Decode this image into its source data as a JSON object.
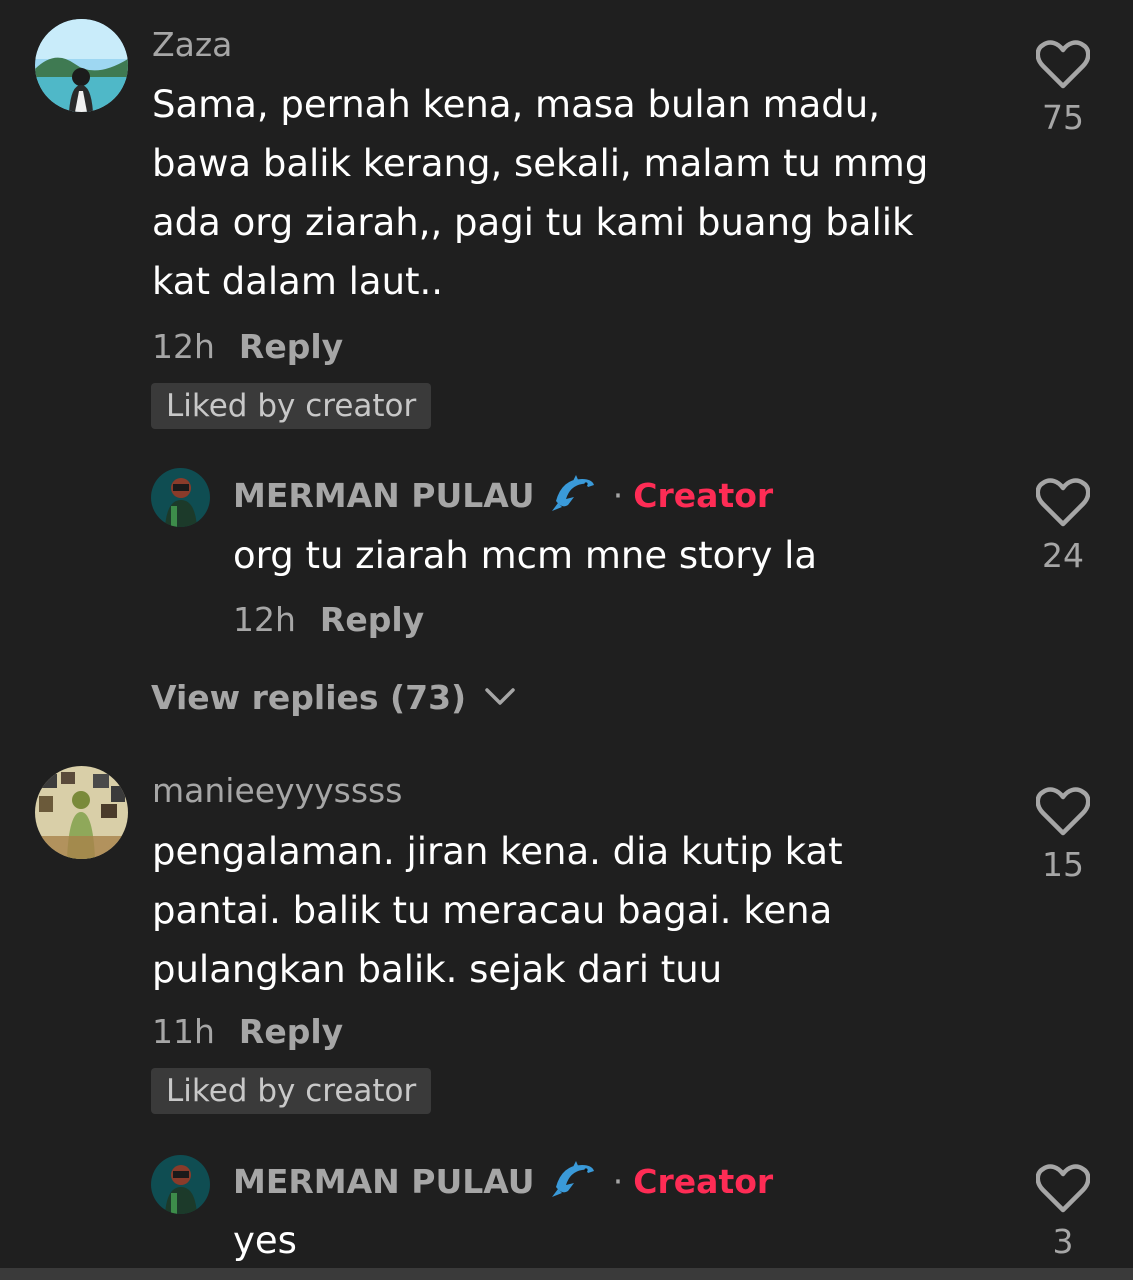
{
  "comments": [
    {
      "username": "Zaza",
      "text": "Sama, pernah kena, masa bulan madu, bawa balik kerang, sekali, malam tu mmg ada org ziarah,, pagi tu kami buang balik kat dalam laut..",
      "time": "12h",
      "reply_label": "Reply",
      "liked_badge": "Liked by creator",
      "likes": "75",
      "creator_reply": {
        "username": "MERMAN PULAU",
        "dot": "·",
        "creator_label": "Creator",
        "text": "org tu ziarah mcm mne story la",
        "time": "12h",
        "reply_label": "Reply",
        "likes": "24"
      },
      "view_replies": "View replies (73)"
    },
    {
      "username": "manieeyyyssss",
      "text": "pengalaman. jiran kena. dia kutip kat pantai. balik tu meracau bagai. kena pulangkan balik. sejak dari tuu",
      "time": "11h",
      "reply_label": "Reply",
      "liked_badge": "Liked by creator",
      "likes": "15",
      "creator_reply": {
        "username": "MERMAN PULAU",
        "dot": "·",
        "creator_label": "Creator",
        "text": "yes",
        "likes": "3"
      }
    }
  ],
  "icons": {
    "like": "heart-outline-icon",
    "expand": "chevron-down-icon",
    "emoji": "dolphin-emoji"
  },
  "colors": {
    "background": "#1f1f1f",
    "creator_accent": "#fe2c55",
    "muted_text": "#a6a6a6",
    "badge_bg": "#3a3a3a"
  }
}
